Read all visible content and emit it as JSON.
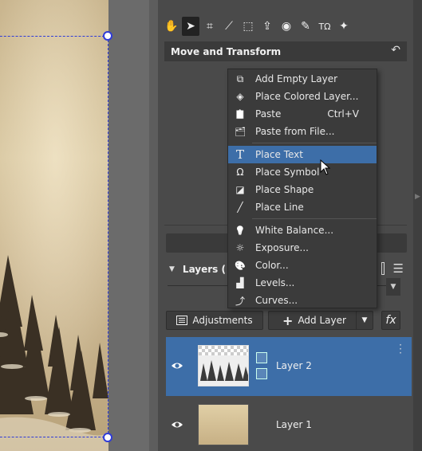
{
  "toolbar": {
    "tools": [
      {
        "icon": "hand-icon",
        "active": false
      },
      {
        "icon": "arrow-pointer-icon",
        "active": true
      },
      {
        "icon": "crop-icon",
        "active": false
      },
      {
        "icon": "straighten-icon",
        "active": false
      },
      {
        "icon": "perspective-icon",
        "active": false
      },
      {
        "icon": "export-icon",
        "active": false
      },
      {
        "icon": "eye-icon",
        "active": false
      },
      {
        "icon": "brush-icon",
        "active": false
      },
      {
        "icon": "text-icon",
        "active": false
      },
      {
        "icon": "effects-icon",
        "active": false
      }
    ]
  },
  "move_transform": {
    "title": "Move and Transform",
    "reset_icon": "undo-arrow-icon"
  },
  "layers": {
    "title": "Layers (",
    "adjustments_label": "Adjustments",
    "add_layer_label": "Add Layer",
    "fx_label": "fx",
    "items": [
      {
        "name": "Layer 2",
        "selected": true
      },
      {
        "name": "Layer 1",
        "selected": false
      }
    ]
  },
  "context_menu": {
    "groups": [
      [
        {
          "label": "Add Empty Layer",
          "icon": "add-layer-icon",
          "shortcut": ""
        },
        {
          "label": "Place Colored Layer...",
          "icon": "colored-layer-icon",
          "shortcut": ""
        },
        {
          "label": "Paste",
          "icon": "paste-icon",
          "shortcut": "Ctrl+V"
        },
        {
          "label": "Paste from File...",
          "icon": "paste-file-icon",
          "shortcut": ""
        }
      ],
      [
        {
          "label": "Place Text",
          "icon": "text-icon",
          "shortcut": "",
          "hover": true
        },
        {
          "label": "Place Symbol",
          "icon": "omega-icon",
          "shortcut": ""
        },
        {
          "label": "Place Shape",
          "icon": "shape-icon",
          "shortcut": ""
        },
        {
          "label": "Place Line",
          "icon": "line-icon",
          "shortcut": ""
        }
      ],
      [
        {
          "label": "White Balance...",
          "icon": "bulb-icon",
          "shortcut": ""
        },
        {
          "label": "Exposure...",
          "icon": "sun-icon",
          "shortcut": ""
        },
        {
          "label": "Color...",
          "icon": "palette-icon",
          "shortcut": ""
        },
        {
          "label": "Levels...",
          "icon": "levels-icon",
          "shortcut": ""
        },
        {
          "label": "Curves...",
          "icon": "curves-icon",
          "shortcut": ""
        }
      ]
    ]
  },
  "colors": {
    "selection": "#3d6ea8",
    "panel": "#4a4a4a",
    "menu": "#3b3b3b",
    "marquee": "#2f3bd8"
  }
}
